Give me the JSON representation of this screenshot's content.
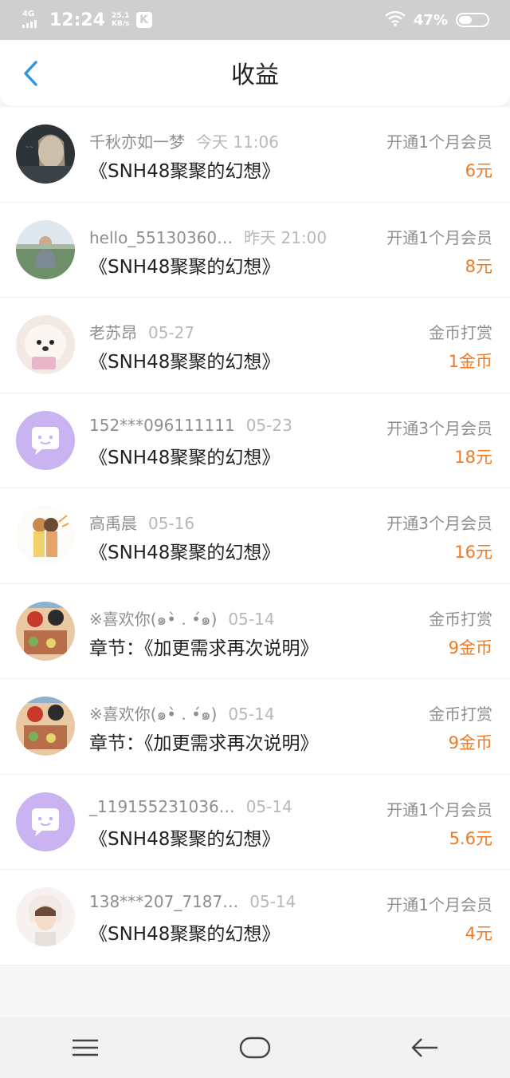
{
  "status_bar": {
    "network": "4G",
    "time": "12:24",
    "speed_value": "25.1",
    "speed_unit": "KB/s",
    "app_badge": "K",
    "battery_percent": "47%",
    "battery_level": 0.47
  },
  "header": {
    "title": "收益",
    "back_icon": "chevron-left-icon"
  },
  "colors": {
    "accent": "#f07a23",
    "back": "#2f95e0",
    "muted": "#8e8e8e",
    "timestamp": "#b8b8b8"
  },
  "earnings": [
    {
      "user": "千秋亦如一梦",
      "time": "今天 11:06",
      "title": "《SNH48聚聚的幻想》",
      "type": "开通1个月会员",
      "amount": "6元",
      "avatar": "photo-girl"
    },
    {
      "user": "hello_55130360…",
      "time": "昨天 21:00",
      "title": "《SNH48聚聚的幻想》",
      "type": "开通1个月会员",
      "amount": "8元",
      "avatar": "photo-man"
    },
    {
      "user": "老苏昂",
      "time": "05-27",
      "title": "《SNH48聚聚的幻想》",
      "type": "金币打赏",
      "amount": "1金币",
      "avatar": "photo-dog"
    },
    {
      "user": "152***096111111",
      "time": "05-23",
      "title": "《SNH48聚聚的幻想》",
      "type": "开通3个月会员",
      "amount": "18元",
      "avatar": "default-chat"
    },
    {
      "user": "高禹晨",
      "time": "05-16",
      "title": "《SNH48聚聚的幻想》",
      "type": "开通3个月会员",
      "amount": "16元",
      "avatar": "anime-couple"
    },
    {
      "user": "※喜欢你(๑•̀ . •́๑)",
      "time": "05-14",
      "title": "章节：《加更需求再次说明》",
      "type": "金币打赏",
      "amount": "9金币",
      "avatar": "anime-drink"
    },
    {
      "user": "※喜欢你(๑•̀ . •́๑)",
      "time": "05-14",
      "title": "章节：《加更需求再次说明》",
      "type": "金币打赏",
      "amount": "9金币",
      "avatar": "anime-drink"
    },
    {
      "user": "_119155231036…",
      "time": "05-14",
      "title": "《SNH48聚聚的幻想》",
      "type": "开通1个月会员",
      "amount": "5.6元",
      "avatar": "default-chat"
    },
    {
      "user": "138***207_7187…",
      "time": "05-14",
      "title": "《SNH48聚聚的幻想》",
      "type": "开通1个月会员",
      "amount": "4元",
      "avatar": "anime-boy"
    }
  ],
  "system_nav": {
    "menu": "menu-icon",
    "home": "home-icon",
    "back": "back-arrow-icon"
  }
}
